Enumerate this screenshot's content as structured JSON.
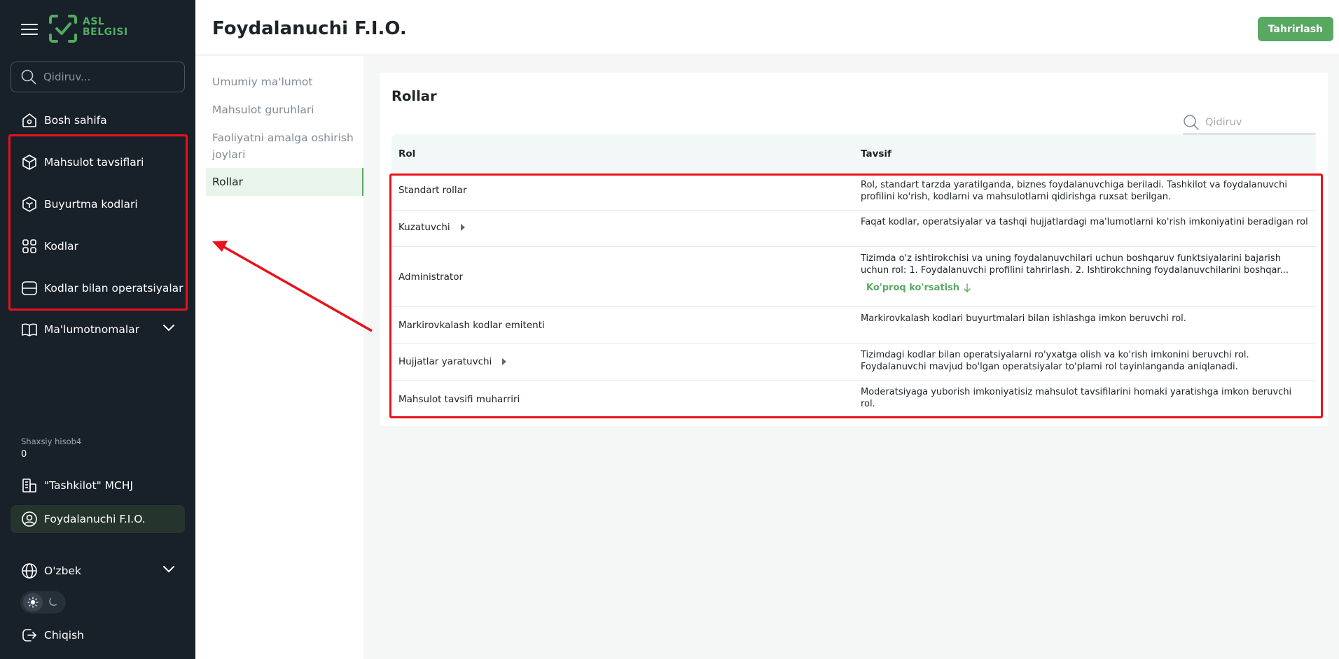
{
  "app": {
    "logo_line1": "ASL",
    "logo_line2": "BELGISI"
  },
  "sidebar": {
    "search_placeholder": "Qidiruv...",
    "items": [
      {
        "label": "Bosh sahifa"
      },
      {
        "label": "Mahsulot tavsiflari"
      },
      {
        "label": "Buyurtma kodlari"
      },
      {
        "label": "Kodlar"
      },
      {
        "label": "Kodlar bilan operatsiyalar"
      },
      {
        "label": "Ma'lumotnomalar"
      }
    ],
    "account_label": "Shaxsiy hisob4",
    "account_value": "0",
    "organization": "\"Tashkilot\" MCHJ",
    "user": "Foydalanuchi F.I.O.",
    "language": "O'zbek",
    "logout": "Chiqish"
  },
  "header": {
    "title": "Foydalanuchi F.I.O.",
    "edit_button": "Tahrirlash"
  },
  "subnav": {
    "items": [
      {
        "label": "Umumiy ma'lumot"
      },
      {
        "label": "Mahsulot guruhlari"
      },
      {
        "label": "Faoliyatni amalga oshirish joylari"
      },
      {
        "label": "Rollar"
      }
    ],
    "active_index": 3
  },
  "roles": {
    "title": "Rollar",
    "search_placeholder": "Qidiruv",
    "columns": {
      "role": "Rol",
      "description": "Tavsif"
    },
    "rows": [
      {
        "role": "Standart rollar",
        "description": "Rol, standart tarzda yaratilganda, biznes foydalanuvchiga beriladi. Tashkilot va foydalanuvchi profilini ko'rish, kodlarni va mahsulotlarni qidirishga ruxsat berilgan."
      },
      {
        "role": "Kuzatuvchi",
        "description": "Faqat kodlar, operatsiyalar va tashqi hujjatlardagi ma'lumotlarni ko'rish imkoniyatini beradigan rol"
      },
      {
        "role": "Administrator",
        "description": "Tizimda o'z ishtirokchisi va uning foydalanuvchilari uchun boshqaruv funktsiyalarini bajarish uchun rol: 1. Foydalanuvchi profilini tahrirlash. 2. Ishtirokchning foydalanuvchilarini boshqar...",
        "more": "Ko'proq ko'rsatish"
      },
      {
        "role": "Markirovkalash kodlar emitenti",
        "description": "Markirovkalash kodlari buyurtmalari bilan ishlashga imkon beruvchi rol."
      },
      {
        "role": "Hujjatlar yaratuvchi",
        "description": "Tizimdagi kodlar bilan operatsiyalarni ro'yxatga olish va ko'rish imkonini beruvchi rol. Foydalanuvchi mavjud bo'lgan operatsiyalar to'plami rol tayinlanganda aniqlanadi."
      },
      {
        "role": "Mahsulot tavsifi muharriri",
        "description": "Moderatsiyaga yuborish imkoniyatisiz mahsulot tavsifilarini homaki yaratishga imkon beruvchi rol."
      }
    ]
  },
  "colors": {
    "accent": "#58a862",
    "sidebar_bg": "#18202a",
    "annotation": "#e8121a"
  },
  "icons": [
    "menu-icon",
    "search-icon",
    "home-icon",
    "box-icon",
    "order-box-icon",
    "qr-scan-icon",
    "operations-icon",
    "book-icon",
    "chevron-down-icon",
    "building-icon",
    "user-circle-icon",
    "globe-icon",
    "sun-icon",
    "moon-icon",
    "logout-icon",
    "caret-right-icon",
    "arrow-down-icon"
  ]
}
